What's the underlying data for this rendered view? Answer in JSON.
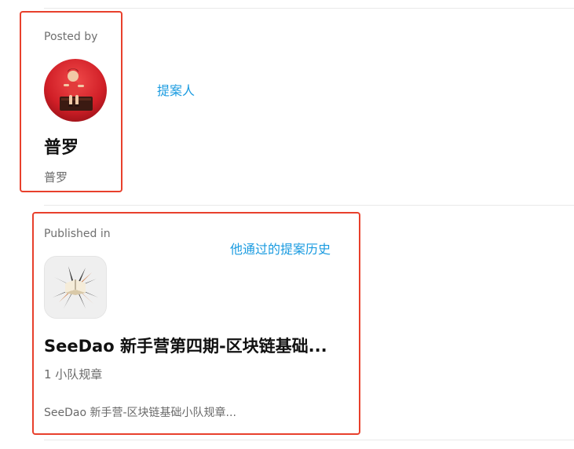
{
  "author_section": {
    "label": "Posted by",
    "name": "普罗",
    "handle": "普罗",
    "annotation": "提案人"
  },
  "publication_section": {
    "label": "Published in",
    "title": "SeeDao 新手营第四期-区块链基础...",
    "members": "1 小队规章",
    "description": "SeeDao 新手营-区块链基础小队规章...",
    "annotation": "他通过的提案历史"
  },
  "colors": {
    "highlight_border": "#e8402c",
    "annotation_text": "#1a9be0",
    "avatar_background": "#d8262e"
  },
  "icons": {
    "avatar": "user-avatar-photo",
    "publication_logo": "publication-logo"
  }
}
